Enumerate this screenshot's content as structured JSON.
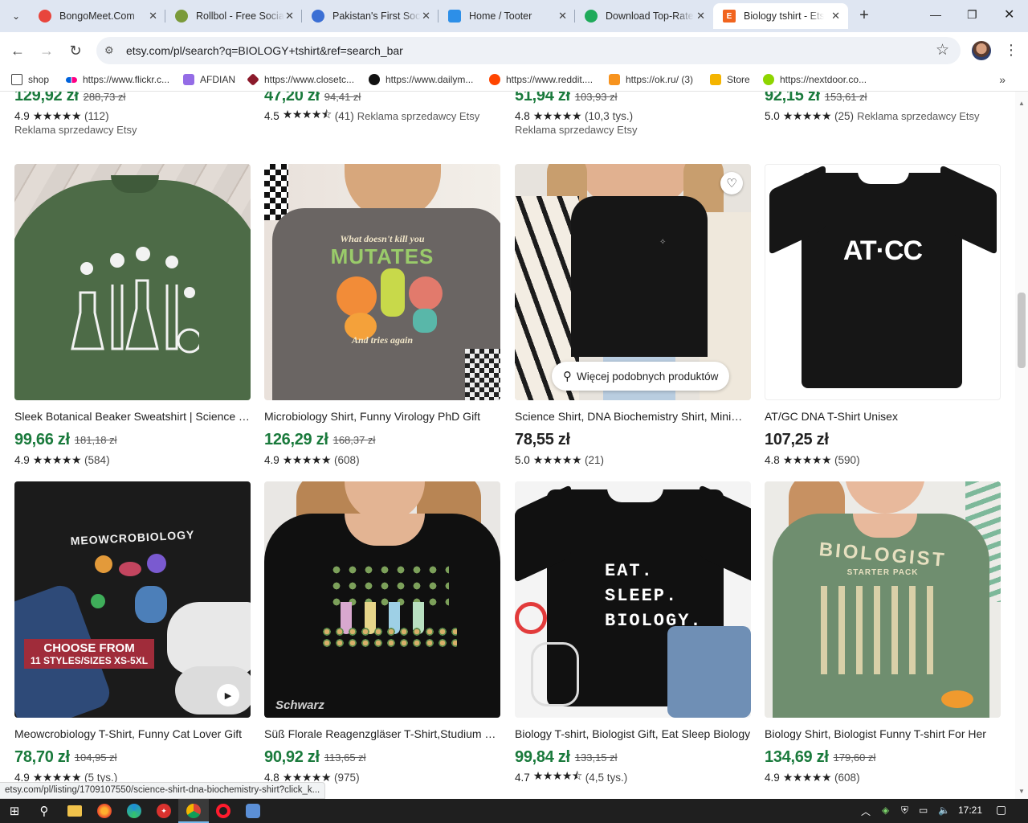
{
  "browser": {
    "tabs": [
      {
        "title": "BongoMeet.Com",
        "icon": "chrome-icon",
        "color": "#e8453c"
      },
      {
        "title": "Rollbol - Free Social",
        "icon": "rollbol-icon",
        "color": "#7a9a3a"
      },
      {
        "title": "Pakistan's First Social",
        "icon": "globe-icon",
        "color": "#3b6fd4"
      },
      {
        "title": "Home / Tooter",
        "icon": "tooter-icon",
        "color": "#2d8fe8"
      },
      {
        "title": "Download Top-Rated",
        "icon": "download-icon",
        "color": "#1faa5a"
      },
      {
        "title": "Biology tshirt - Etsy",
        "icon": "etsy-icon",
        "color": "#f1641e"
      }
    ],
    "url": "etsy.com/pl/search?q=BIOLOGY+tshirt&ref=search_bar",
    "bookmarks": [
      {
        "label": "shop",
        "icon": "folder-icon",
        "color": "#444"
      },
      {
        "label": "https://www.flickr.c...",
        "icon": "flickr-icon",
        "color": "#ff0084"
      },
      {
        "label": "AFDIAN",
        "icon": "afdian-icon",
        "color": "#946ce6"
      },
      {
        "label": "https://www.closetc...",
        "icon": "closet-icon",
        "color": "#8b1a2b"
      },
      {
        "label": "https://www.dailym...",
        "icon": "dailymotion-icon",
        "color": "#111"
      },
      {
        "label": "https://www.reddit....",
        "icon": "reddit-icon",
        "color": "#ff4500"
      },
      {
        "label": "https://ok.ru/ (3)",
        "icon": "ok-icon",
        "color": "#f7931e"
      },
      {
        "label": "Store",
        "icon": "store-icon",
        "color": "#f4b400"
      },
      {
        "label": "https://nextdoor.co...",
        "icon": "nextdoor-icon",
        "color": "#8ed500"
      }
    ],
    "status_url": "etsy.com/pl/listing/1709107550/science-shirt-dna-biochemistry-shirt?click_k..."
  },
  "top_row": [
    {
      "price": "129,92 zł",
      "old": "288,73 zł",
      "rating": "4.9",
      "count": "(112)",
      "ad": "Reklama sprzedawcy Etsy",
      "ad_inline": false
    },
    {
      "price": "47,20 zł",
      "old": "94,41 zł",
      "rating": "4.5",
      "count": "(41)",
      "ad": "Reklama sprzedawcy Etsy",
      "ad_inline": true
    },
    {
      "price": "51,94 zł",
      "old": "103,93 zł",
      "rating": "4.8",
      "count": "(10,3 tys.)",
      "ad": "Reklama sprzedawcy Etsy",
      "ad_inline": false
    },
    {
      "price": "92,15 zł",
      "old": "153,61 zł",
      "rating": "5.0",
      "count": "(25)",
      "ad": "Reklama sprzedawcy Etsy",
      "ad_inline": true
    }
  ],
  "listings": [
    {
      "title": "Sleek Botanical Beaker Sweatshirt | Science Teacher",
      "price": "99,66 zł",
      "old": "181,18 zł",
      "rating": "4.9",
      "count": "(584)"
    },
    {
      "title": "Microbiology Shirt, Funny Virology PhD Gift",
      "price": "126,29 zł",
      "old": "168,37 zł",
      "rating": "4.9",
      "count": "(608)",
      "shirt_top": "What doesn't kill you",
      "shirt_big": "MUTATES",
      "shirt_bottom": "And tries again"
    },
    {
      "title": "Science Shirt, DNA Biochemistry Shirt, Minimalist",
      "price": "78,55 zł",
      "old": "",
      "rating": "5.0",
      "count": "(21)",
      "similar": "Więcej podobnych produktów"
    },
    {
      "title": "AT/GC DNA T-Shirt Unisex",
      "price": "107,25 zł",
      "old": "",
      "rating": "4.8",
      "count": "(590)",
      "shirt_big": "AT·CC"
    },
    {
      "title": "Meowcrobiology T-Shirt, Funny Cat Lover Gift",
      "price": "78,70 zł",
      "old": "104,95 zł",
      "rating": "4.9",
      "count": "(5 tys.)",
      "shirt_top": "MEOWCROBIOLOGY",
      "banner1": "CHOOSE FROM",
      "banner2": "11 STYLES/SIZES XS-5XL"
    },
    {
      "title": "Süß Florale Reagenzgläser T-Shirt,Studium Geschenk",
      "price": "90,92 zł",
      "old": "113,65 zł",
      "rating": "4.8",
      "count": "(975)",
      "brand": "Schwarz"
    },
    {
      "title": "Biology T-shirt, Biologist Gift, Eat Sleep Biology",
      "price": "99,84 zł",
      "old": "133,15 zł",
      "rating": "4.7",
      "count": "(4,5 tys.)",
      "shirt_lines": [
        "EAT.",
        "SLEEP.",
        "BIOLOGY."
      ]
    },
    {
      "title": "Biology Shirt, Biologist Funny T-shirt For Her",
      "price": "134,69 zł",
      "old": "179,60 zł",
      "rating": "4.9",
      "count": "(608)",
      "shirt_big": "BIOLOGIST",
      "shirt_top": "STARTER PACK"
    }
  ],
  "taskbar": {
    "time": "17:21"
  },
  "colors": {
    "price_green": "#1a7a3c",
    "etsy_orange": "#f1641e"
  }
}
